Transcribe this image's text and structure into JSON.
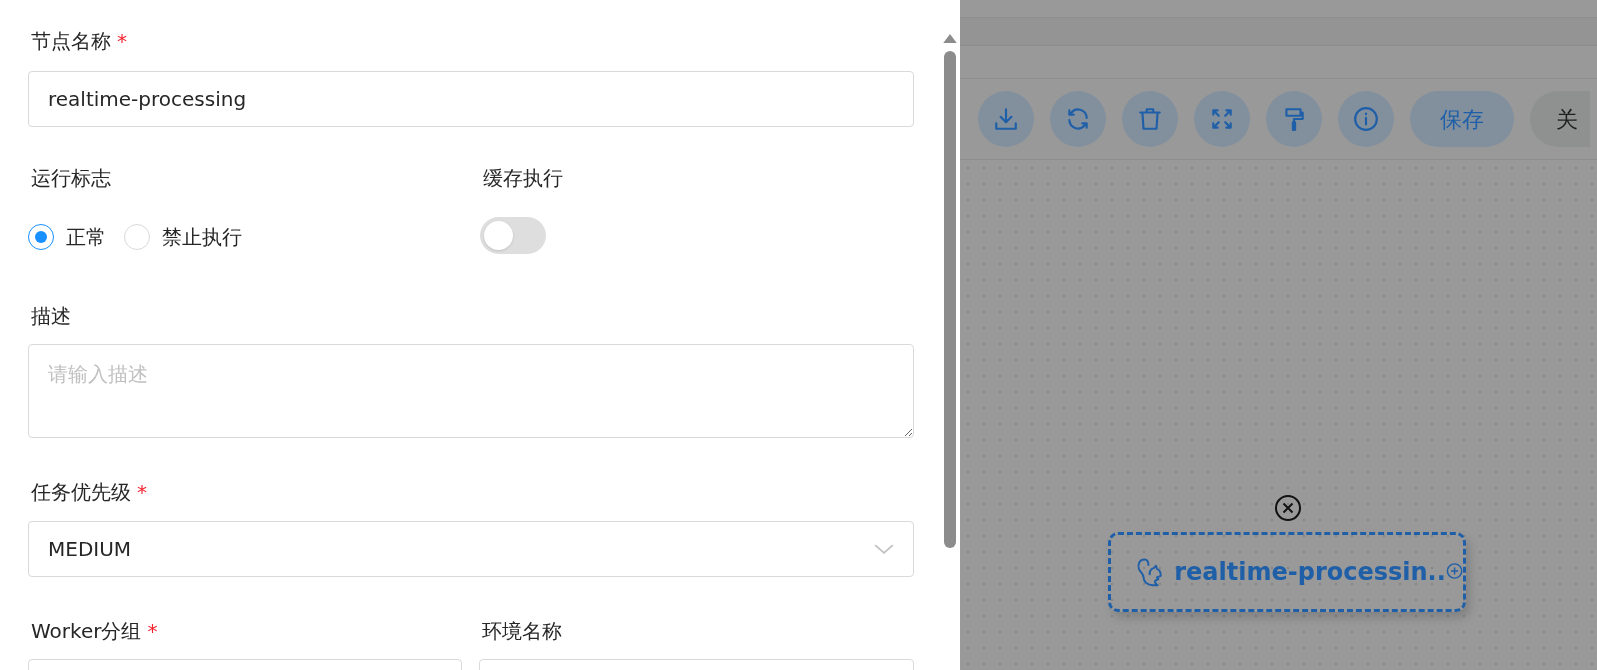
{
  "form": {
    "node_name": {
      "label": "节点名称",
      "required_mark": "*",
      "value": "realtime-processing"
    },
    "run_flag": {
      "label": "运行标志",
      "options": [
        {
          "label": "正常",
          "selected": true
        },
        {
          "label": "禁止执行",
          "selected": false
        }
      ]
    },
    "cache_execute": {
      "label": "缓存执行",
      "on": false
    },
    "description": {
      "label": "描述",
      "placeholder": "请输入描述"
    },
    "priority": {
      "label": "任务优先级",
      "required_mark": "*",
      "value": "MEDIUM"
    },
    "worker_group": {
      "label": "Worker分组",
      "required_mark": "*"
    },
    "environment": {
      "label": "环境名称"
    }
  },
  "toolbar": {
    "buttons": [
      {
        "kind": "download"
      },
      {
        "kind": "refresh"
      },
      {
        "kind": "delete"
      },
      {
        "kind": "fullscreen"
      },
      {
        "kind": "format"
      },
      {
        "kind": "info"
      },
      {
        "kind": "primary",
        "label": "保存"
      },
      {
        "kind": "secondary",
        "label": "关"
      }
    ]
  },
  "canvas": {
    "node": {
      "label": "realtime-processin.."
    }
  }
}
